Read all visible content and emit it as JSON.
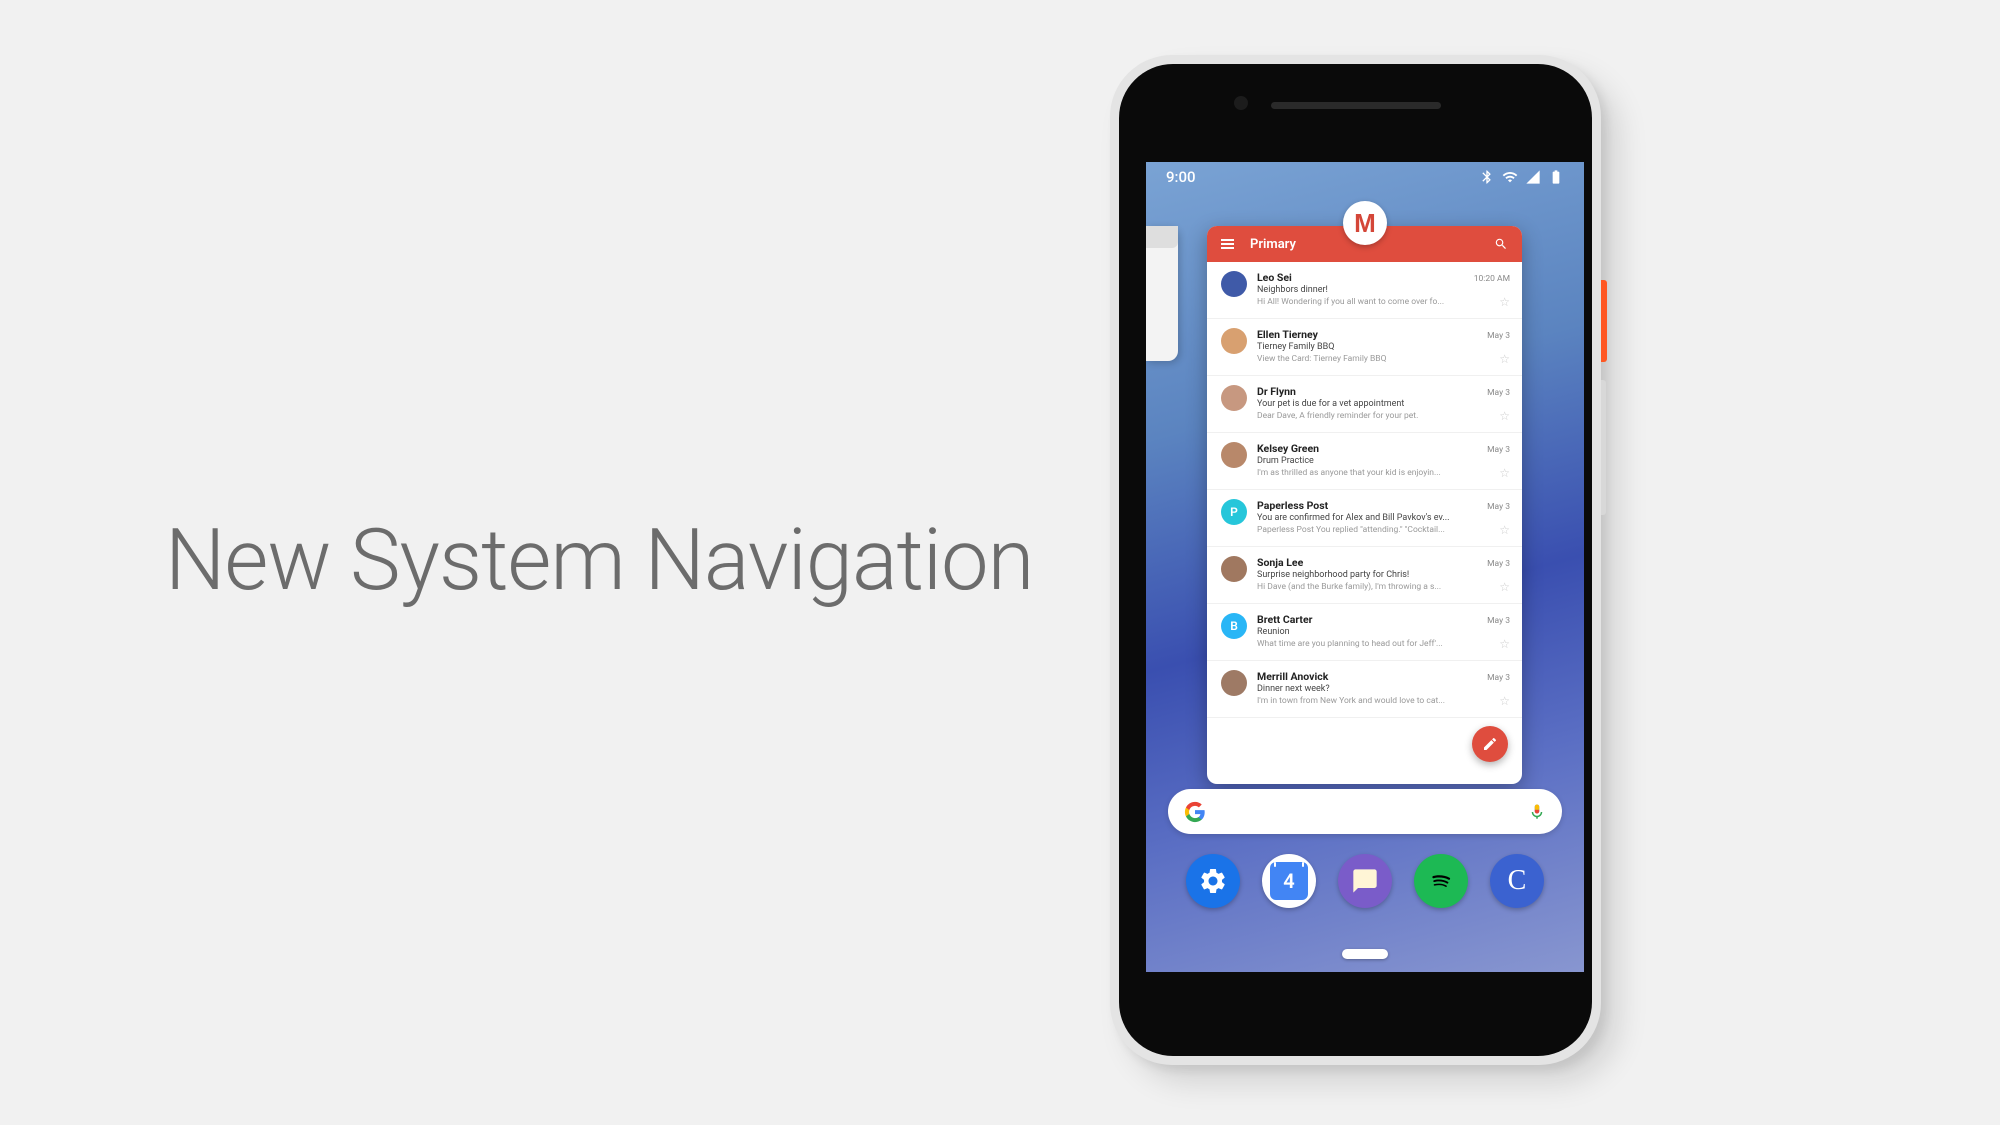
{
  "slide": {
    "title": "New System Navigation"
  },
  "status": {
    "time": "9:00"
  },
  "gmail": {
    "letter": "M",
    "header": "Primary",
    "fab": "compose",
    "items": [
      {
        "sender": "Leo Sei",
        "time": "10:20 AM",
        "subject": "Neighbors dinner!",
        "preview": "Hi All! Wondering if you all want to come over fo...",
        "avBg": "#3f5aa8"
      },
      {
        "sender": "Ellen Tierney",
        "time": "May 3",
        "subject": "Tierney Family BBQ",
        "preview": "View the Card: Tierney Family BBQ",
        "avBg": "#d8a070"
      },
      {
        "sender": "Dr Flynn",
        "time": "May 3",
        "subject": "Your pet is due for a vet appointment",
        "preview": "Dear Dave, A friendly reminder for your pet.",
        "avBg": "#c79880"
      },
      {
        "sender": "Kelsey Green",
        "time": "May 3",
        "subject": "Drum Practice",
        "preview": "I'm as thrilled as anyone that your kid is enjoyin...",
        "avBg": "#b8886a"
      },
      {
        "sender": "Paperless Post",
        "time": "May 3",
        "subject": "You are confirmed for Alex and Bill Pavkov's ev...",
        "preview": "Paperless Post You replied \"attending.\" \"Cocktail...",
        "avBg": "#26c6da",
        "letter": "P"
      },
      {
        "sender": "Sonja Lee",
        "time": "May 3",
        "subject": "Surprise neighborhood party for Chris!",
        "preview": "Hi Dave (and the Burke family), I'm throwing a s...",
        "avBg": "#a07860"
      },
      {
        "sender": "Brett Carter",
        "time": "May 3",
        "subject": "Reunion",
        "preview": "What time are you planning to head out for Jeff'...",
        "avBg": "#29b6f6",
        "letter": "B"
      },
      {
        "sender": "Merrill Anovick",
        "time": "May 3",
        "subject": "Dinner next week?",
        "preview": "I'm in town from New York and would love to cat...",
        "avBg": "#9e7a65"
      }
    ]
  },
  "apps": {
    "calendar_day": "4"
  }
}
